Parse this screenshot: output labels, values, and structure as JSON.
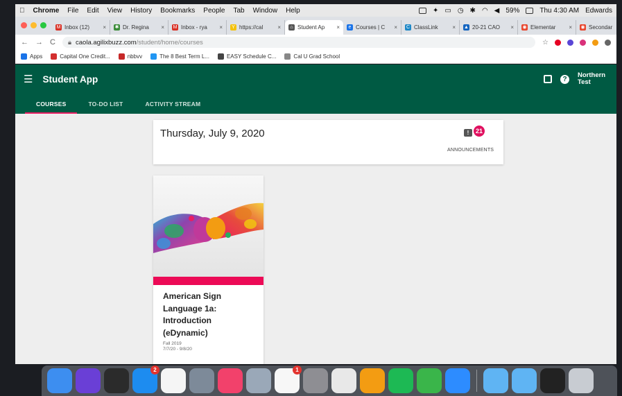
{
  "menubar": {
    "apple": "",
    "app": "Chrome",
    "items": [
      "File",
      "Edit",
      "View",
      "History",
      "Bookmarks",
      "People",
      "Tab",
      "Window",
      "Help"
    ],
    "battery": "59%",
    "clock": "Thu 4:30 AM",
    "user": "Edwards"
  },
  "tabs": [
    {
      "title": "Inbox (12)",
      "color": "#d93025",
      "glyph": "M"
    },
    {
      "title": "Dr. Regina",
      "color": "#3c8c3a",
      "glyph": "✱"
    },
    {
      "title": "Inbox - rya",
      "color": "#d93025",
      "glyph": "M"
    },
    {
      "title": "https://cal",
      "color": "#f4c20d",
      "glyph": "Y"
    },
    {
      "title": "Student Ap",
      "color": "#555555",
      "glyph": "⌂",
      "active": true
    },
    {
      "title": "Courses | C",
      "color": "#1a73e8",
      "glyph": "e"
    },
    {
      "title": "ClassLink",
      "color": "#1e88c7",
      "glyph": "C"
    },
    {
      "title": "20-21 CAO",
      "color": "#1565c0",
      "glyph": "▲"
    },
    {
      "title": "Elementar",
      "color": "#e8452c",
      "glyph": "◉"
    },
    {
      "title": "Secondar",
      "color": "#e8452c",
      "glyph": "◉"
    }
  ],
  "address": {
    "host": "caola.agilixbuzz.com",
    "path": "/student/home/courses"
  },
  "bookmarks": [
    {
      "label": "Apps",
      "color": "#1a73e8"
    },
    {
      "label": "Capital One Credit...",
      "color": "#d32f2f"
    },
    {
      "label": "nbbvv",
      "color": "#c62828"
    },
    {
      "label": "The 8 Best Term L...",
      "color": "#2196f3"
    },
    {
      "label": "EASY Schedule C...",
      "color": "#444444"
    },
    {
      "label": "Cal U Grad School",
      "color": "#888888"
    }
  ],
  "app": {
    "title": "Student App",
    "user_name": "Northern Test",
    "nav_tabs": [
      "COURSES",
      "TO-DO LIST",
      "ACTIVITY STREAM"
    ],
    "brand_color": "#005a43",
    "accent_color": "#e91e63"
  },
  "datecard": {
    "date": "Thursday, July 9, 2020",
    "announcement_count": "21",
    "announcements_label": "ANNOUNCEMENTS"
  },
  "course": {
    "title": "American Sign Language 1a: Introduction (eDynamic)",
    "term": "Fall 2019",
    "dates": "7/7/20 - 9/8/20"
  },
  "dock": {
    "apps": [
      {
        "name": "finder-icon",
        "color": "#3d8ef0"
      },
      {
        "name": "siri-icon",
        "color": "#6a3fd6"
      },
      {
        "name": "dashboard-icon",
        "color": "#2b2b2b"
      },
      {
        "name": "app-store-icon",
        "color": "#1d8cf0",
        "badge": "2"
      },
      {
        "name": "calendar-icon",
        "color": "#f5f5f5"
      },
      {
        "name": "launchpad-icon",
        "color": "#7d8a99"
      },
      {
        "name": "music-icon",
        "color": "#f2416b"
      },
      {
        "name": "preview-icon",
        "color": "#9aa8b8"
      },
      {
        "name": "photos-icon",
        "color": "#f7f7f7",
        "badge": "1"
      },
      {
        "name": "system-preferences-icon",
        "color": "#8e8e93"
      },
      {
        "name": "chrome-icon",
        "color": "#e8e8e8"
      },
      {
        "name": "pages-icon",
        "color": "#f39c12"
      },
      {
        "name": "spotify-icon",
        "color": "#1db954"
      },
      {
        "name": "numbers-icon",
        "color": "#3ab54a"
      },
      {
        "name": "zoom-icon",
        "color": "#2d8cff"
      },
      {
        "name": "applications-folder-icon",
        "color": "#5fb4f3"
      },
      {
        "name": "documents-folder-icon",
        "color": "#5fb4f3"
      },
      {
        "name": "book-icon",
        "color": "#222222"
      },
      {
        "name": "trash-icon",
        "color": "#c8ccd2"
      }
    ]
  }
}
